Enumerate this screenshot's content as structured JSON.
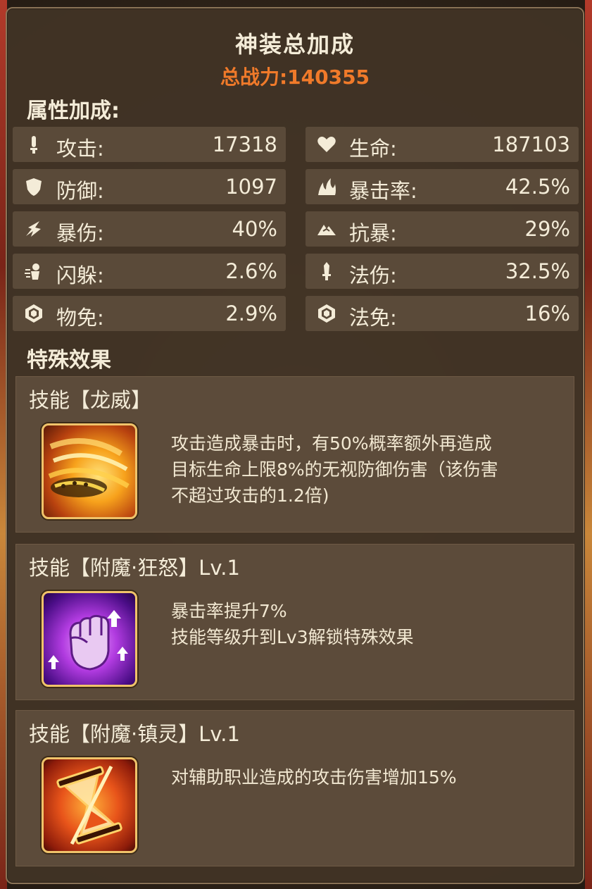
{
  "header": {
    "title": "神装总加成",
    "power_label": "总战力:",
    "power_value": "140355"
  },
  "attributes": {
    "section_label": "属性加成:",
    "left": [
      {
        "icon": "sword-icon",
        "name": "攻击:",
        "value": "17318"
      },
      {
        "icon": "shield-icon",
        "name": "防御:",
        "value": "1097"
      },
      {
        "icon": "burst-icon",
        "name": "暴伤:",
        "value": "40%"
      },
      {
        "icon": "dodge-icon",
        "name": "闪躲:",
        "value": "2.6%"
      },
      {
        "icon": "hexagon-icon",
        "name": "物免:",
        "value": "2.9%"
      }
    ],
    "right": [
      {
        "icon": "heart-icon",
        "name": "生命:",
        "value": "187103"
      },
      {
        "icon": "flame-icon",
        "name": "暴击率:",
        "value": "42.5%"
      },
      {
        "icon": "mountain-icon",
        "name": "抗暴:",
        "value": "29%"
      },
      {
        "icon": "dagger-icon",
        "name": "法伤:",
        "value": "32.5%"
      },
      {
        "icon": "hexagon-icon",
        "name": "法免:",
        "value": "16%"
      }
    ]
  },
  "effects": {
    "section_label": "特殊效果",
    "skills": [
      {
        "title": "技能【龙威】",
        "icon": "dragon-claw-icon",
        "lines": [
          "攻击造成暴击时，有50%概率额外再造成",
          "目标生命上限8%的无视防御伤害（该伤害",
          "不超过攻击的1.2倍)"
        ]
      },
      {
        "title": "技能【附魔·狂怒】Lv.1",
        "icon": "fist-icon",
        "lines": [
          "暴击率提升7%",
          "技能等级升到Lv3解锁特殊效果"
        ]
      },
      {
        "title": "技能【附魔·镇灵】Lv.1",
        "icon": "hourglass-icon",
        "lines": [
          "对辅助职业造成的攻击伤害增加15%"
        ]
      }
    ]
  },
  "colors": {
    "accent_orange": "#f07a2a",
    "text_cream": "#f4ecd8",
    "panel_brown": "#423426",
    "row_brown": "#5a4a39",
    "icon_gold": "#f0c36a"
  }
}
